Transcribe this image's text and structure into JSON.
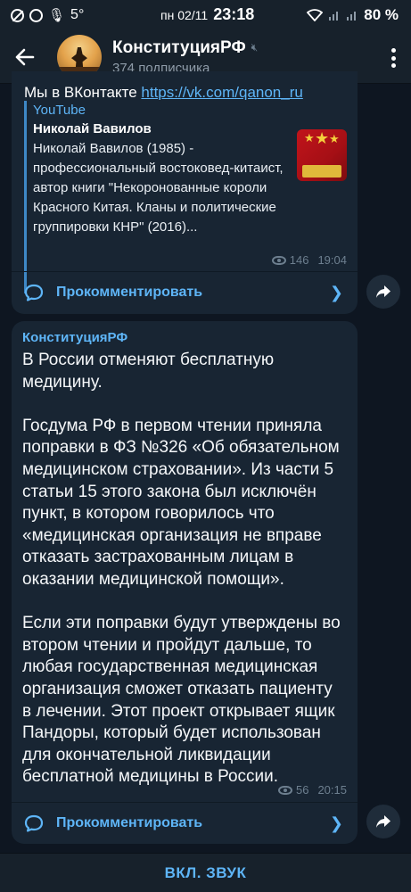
{
  "status_bar": {
    "signal_temp": "5°",
    "date": "пн 02/11",
    "time": "23:18",
    "battery": "80 %"
  },
  "header": {
    "title": "КонституцияРФ",
    "subtitle": "374 подписчика"
  },
  "messages": [
    {
      "cut_text": "Мы в ВКонтакте ",
      "cut_link": "https://vk.com/qanon_ru",
      "preview": {
        "site": "YouTube",
        "title": "Николай Вавилов",
        "description": "Николай Вавилов (1985) - профессиональный востоковед-китаист, автор книги \"Некоронованные короли Красного Китая. Кланы и политические группировки КНР\" (2016)..."
      },
      "views": "146",
      "time": "19:04",
      "comment_label": "Прокомментировать"
    },
    {
      "sender": "КонституцияРФ",
      "text": "В России отменяют бесплатную медицину.\n\nГосдума РФ в первом чтении приняла поправки в ФЗ №326 «Об обязательном медицинском страховании». Из части 5 статьи 15 этого закона был исключён пункт, в котором говорилось что «медицинская организация не вправе отказать застрахованным лицам в оказании медицинской помощи».\n\nЕсли эти поправки будут утверждены во втором чтении и пройдут дальше, то любая государственная медицинская организация сможет отказать пациенту в лечении. Этот проект открывает ящик Пандоры, который будет использован для окончательной ликвидации бесплатной медицины в России.",
      "views": "56",
      "time": "20:15",
      "comment_label": "Прокомментировать"
    }
  ],
  "bottom_bar": {
    "unmute_label": "ВКЛ. ЗВУК"
  },
  "colors": {
    "background": "#0e1621",
    "bubble": "#182533",
    "accent": "#5eb5f7",
    "meta": "#6d7f8f"
  },
  "icons": [
    "back-arrow-icon",
    "mute-icon",
    "more-vert-icon",
    "eye-icon",
    "comment-icon",
    "chevron-right-icon",
    "share-icon"
  ]
}
